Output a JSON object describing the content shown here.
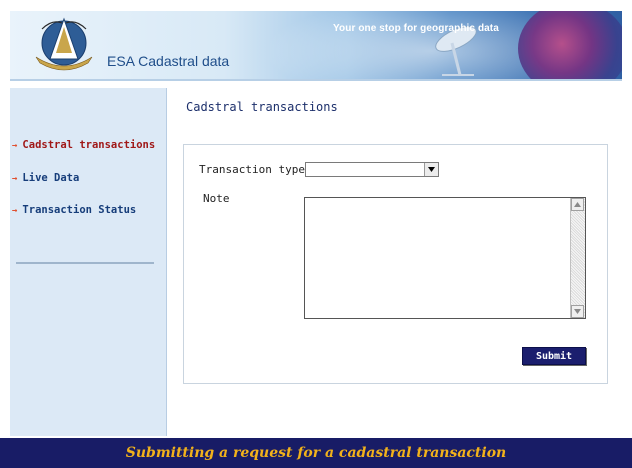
{
  "header": {
    "app_title": "ESA Cadastral data",
    "tagline": "Your one stop for geographic data"
  },
  "sidebar": {
    "items": [
      {
        "label": "Cadstral transactions",
        "active": true
      },
      {
        "label": "Live Data",
        "active": false
      },
      {
        "label": "Transaction Status",
        "active": false
      }
    ]
  },
  "main": {
    "title": "Cadstral transactions",
    "form": {
      "transaction_type_label": "Transaction type",
      "transaction_type_value": "",
      "note_label": "Note",
      "note_value": "",
      "submit_label": "Submit"
    }
  },
  "caption": "Submitting a request for a cadastral transaction",
  "colors": {
    "caption_bg": "#181c66",
    "caption_text": "#f2b21b",
    "sidebar_bg": "#dce9f6",
    "active_nav": "#a01818",
    "nav": "#163d7a",
    "submit_bg": "#1b1e6e"
  },
  "icons": {
    "logo": "esa-emblem-icon",
    "nav_arrow": "right-arrow-icon",
    "dropdown": "chevron-down-icon",
    "scroll_up": "scroll-up-icon",
    "scroll_down": "scroll-down-icon"
  }
}
